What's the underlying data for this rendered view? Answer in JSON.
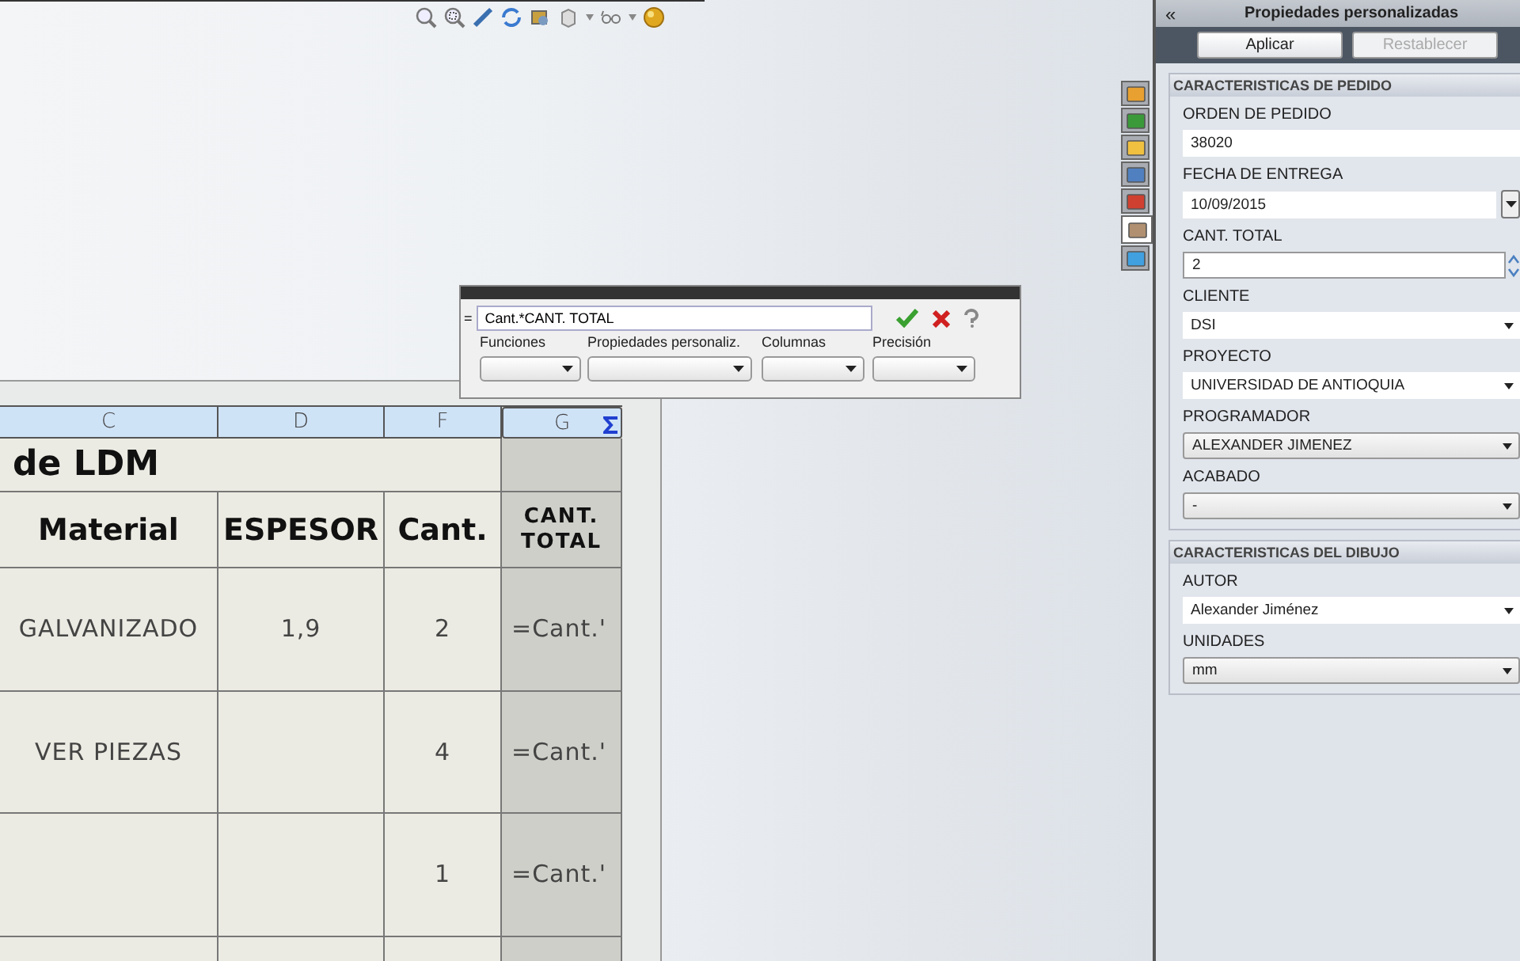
{
  "formula_editor": {
    "prefix": "=",
    "value": "Cant.*CANT. TOTAL",
    "dropdowns": [
      {
        "label": "Funciones"
      },
      {
        "label": "Propiedades personaliz."
      },
      {
        "label": "Columnas"
      },
      {
        "label": "Precisión"
      }
    ]
  },
  "table": {
    "title": "de LDM",
    "columns": [
      {
        "letter": "C",
        "header": "Material",
        "selected": false
      },
      {
        "letter": "D",
        "header": "ESPESOR",
        "selected": false
      },
      {
        "letter": "F",
        "header": "Cant.",
        "selected": false
      },
      {
        "letter": "G",
        "header": "CANT.\nTOTAL",
        "selected": true
      }
    ],
    "rows": [
      {
        "material": "GALVANIZADO",
        "espesor": "1,9",
        "cant": "2",
        "total": "=Cant.'"
      },
      {
        "material": "VER PIEZAS",
        "cant": "4",
        "total": "=Cant.'"
      },
      {
        "cant": "1",
        "total": "=Cant.'"
      },
      {}
    ]
  },
  "side_tabs": [
    {
      "selected": false
    },
    {
      "selected": false
    },
    {
      "selected": false
    },
    {
      "selected": false
    },
    {
      "selected": false
    },
    {
      "selected": true
    },
    {
      "selected": false
    }
  ],
  "panel": {
    "collapse": "«",
    "title": "Propiedades personalizadas",
    "buttons": [
      {
        "label": "Aplicar",
        "disabled": false
      },
      {
        "label": "Restablecer",
        "disabled": true
      }
    ],
    "sections": [
      {
        "title": "CARACTERISTICAS DE PEDIDO",
        "fields": [
          {
            "label": "ORDEN DE PEDIDO",
            "value": "38020",
            "kind": "text"
          },
          {
            "label": "FECHA DE ENTREGA",
            "value": "10/09/2015",
            "kind": "date"
          },
          {
            "label": "CANT. TOTAL",
            "value": "2",
            "kind": "spin"
          },
          {
            "label": "CLIENTE",
            "value": "DSI",
            "kind": "combo"
          },
          {
            "label": "PROYECTO",
            "value": "UNIVERSIDAD DE ANTIOQUIA",
            "kind": "combo"
          },
          {
            "label": "PROGRAMADOR",
            "value": "ALEXANDER JIMENEZ",
            "kind": "select"
          },
          {
            "label": "ACABADO",
            "value": "-",
            "kind": "select"
          }
        ]
      },
      {
        "title": "CARACTERISTICAS DEL DIBUJO",
        "fields": [
          {
            "label": "AUTOR",
            "value": "Alexander Jiménez",
            "kind": "combo"
          },
          {
            "label": "UNIDADES",
            "value": "mm",
            "kind": "select"
          }
        ]
      }
    ]
  }
}
